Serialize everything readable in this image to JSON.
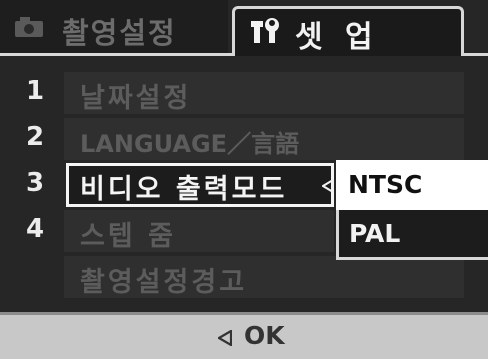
{
  "tabs": [
    {
      "label": "촬영설정",
      "icon": "camera-icon",
      "active": false
    },
    {
      "label": "셋 업",
      "icon": "wrench-icon",
      "active": true
    }
  ],
  "menu": {
    "items": [
      {
        "number": "1",
        "label": "날짜설정"
      },
      {
        "number": "2",
        "label": "LANGUAGE／言語"
      },
      {
        "number": "3",
        "label": "비디오 출력모드"
      },
      {
        "number": "4",
        "label": "스텝 줌"
      },
      {
        "number": "",
        "label": "촬영설정경고"
      }
    ],
    "selected_index": 2
  },
  "options": {
    "items": [
      "NTSC",
      "PAL"
    ],
    "selected": "NTSC"
  },
  "footer": {
    "ok_label": "OK"
  },
  "colors": {
    "background": "#262626",
    "highlight": "#ffffff",
    "footer": "#c8c8c8"
  }
}
